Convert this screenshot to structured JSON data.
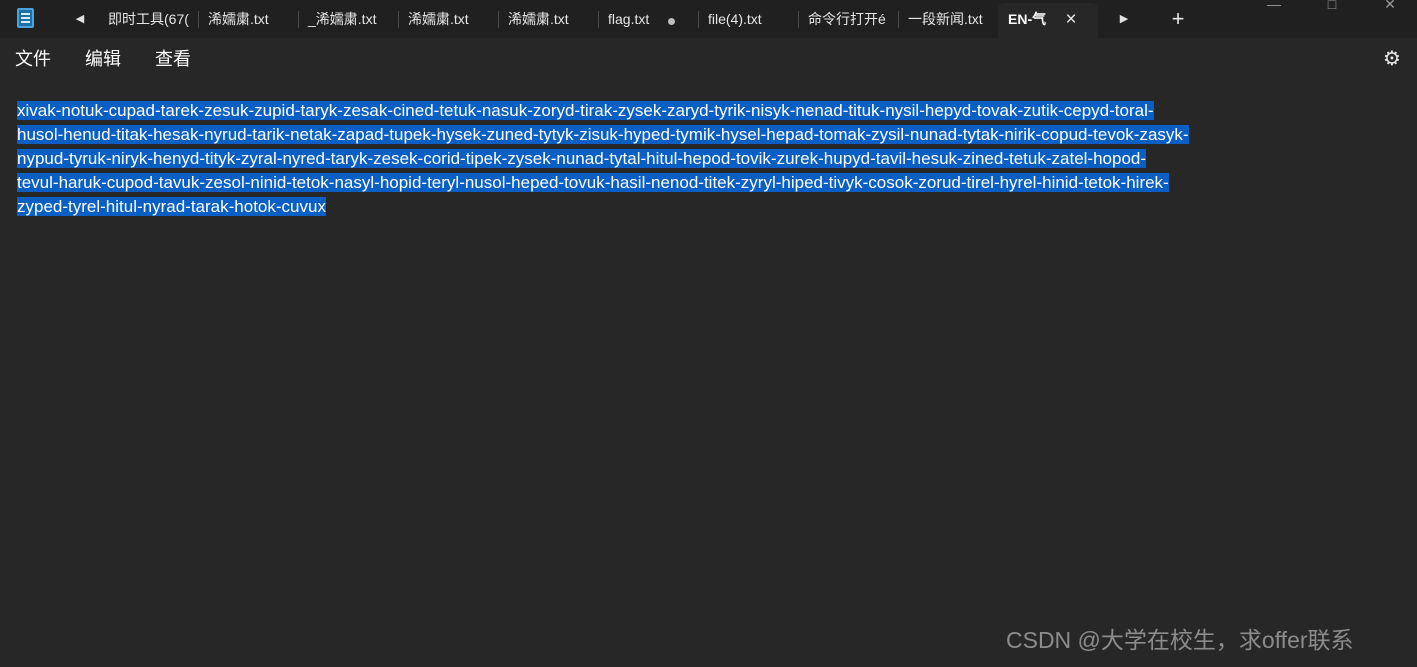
{
  "tabs": [
    {
      "label": "即时工具(67("
    },
    {
      "label": "浠嬬粛.txt"
    },
    {
      "label": "_浠嬬粛.txt"
    },
    {
      "label": "浠嬬粛.txt"
    },
    {
      "label": "浠嬬粛.txt"
    },
    {
      "label": "flag.txt"
    },
    {
      "label": "file(4).txt"
    },
    {
      "label": "命令行打开é"
    },
    {
      "label": "一段新闻.txt"
    },
    {
      "label": "EN-气"
    }
  ],
  "tab_close_glyph": "×",
  "new_tab_glyph": "+",
  "menu": {
    "file": "文件",
    "edit": "编辑",
    "view": "查看"
  },
  "editor": {
    "lines": [
      "xivak-notuk-cupad-tarek-zesuk-zupid-taryk-zesak-cined-tetuk-nasuk-zoryd-tirak-zysek-zaryd-tyrik-nisyk-nenad-tituk-nysil-hepyd-tovak-zutik-cepyd-toral-",
      "husol-henud-titak-hesak-nyrud-tarik-netak-zapad-tupek-hysek-zuned-tytyk-zisuk-hyped-tymik-hysel-hepad-tomak-zysil-nunad-tytak-nirik-copud-tevok-zasyk-",
      "nypud-tyruk-niryk-henyd-tityk-zyral-nyred-taryk-zesek-corid-tipek-zysek-nunad-tytal-hitul-hepod-tovik-zurek-hupyd-tavil-hesuk-zined-tetuk-zatel-hopod-",
      "tevul-haruk-cupod-tavuk-zesol-ninid-tetok-nasyl-hopid-teryl-nusol-heped-tovuk-hasil-nenod-titek-zyryl-hiped-tivyk-cosok-zorud-tirel-hyrel-hinid-tetok-hirek-",
      "zyped-tyrel-hitul-nyrad-tarak-hotok-cuvux"
    ]
  },
  "watermark": "CSDN @大学在校生，求offer联系",
  "colors": {
    "background": "#272727",
    "titlebar": "#202020",
    "selection": "#0a5fc4",
    "watermark": "#8c8c8c"
  },
  "icons": {
    "app": "notepad-icon",
    "scroll_left": "caret-left-icon",
    "scroll_right": "caret-right-icon",
    "new_tab": "plus-icon",
    "settings": "gear-icon",
    "unsaved": "dot-icon",
    "close": "close-icon"
  }
}
